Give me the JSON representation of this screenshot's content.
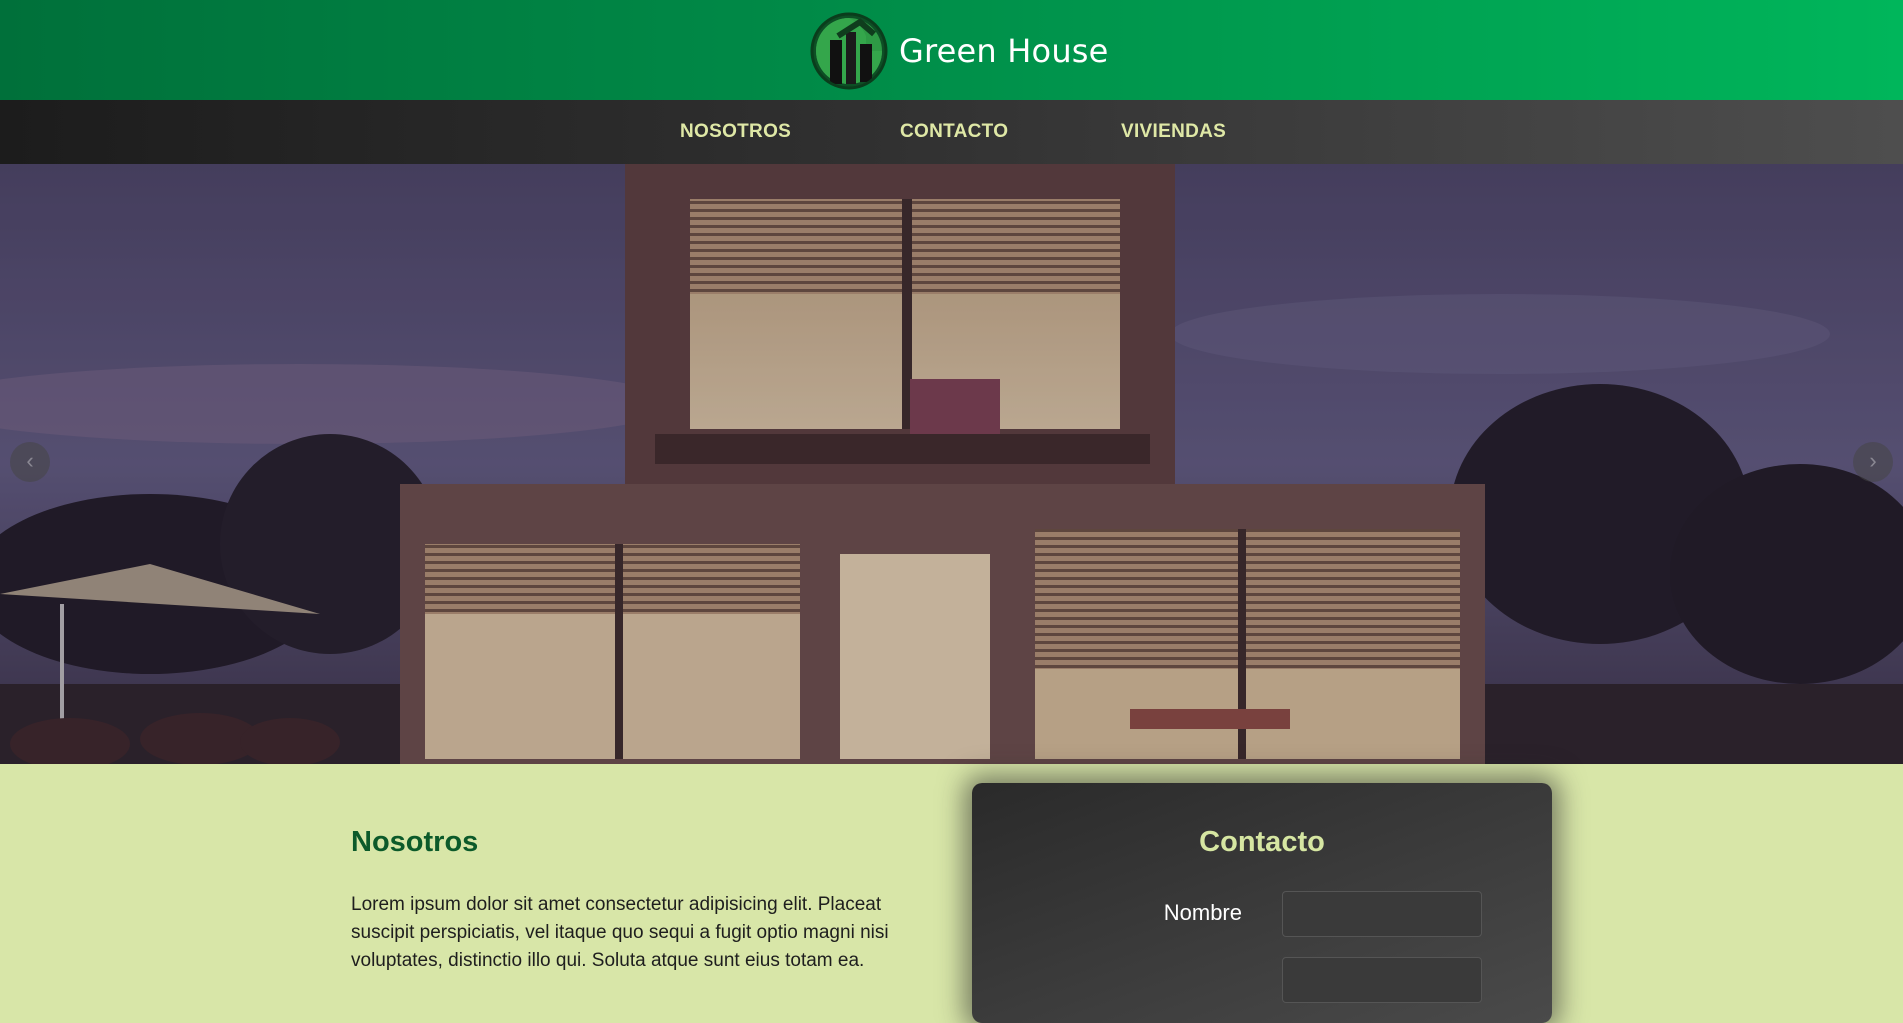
{
  "header": {
    "brand": "Green House",
    "logo_icon": "green-house-logo"
  },
  "nav": {
    "items": [
      {
        "label": "NOSOTROS"
      },
      {
        "label": "CONTACTO"
      },
      {
        "label": "VIVIENDAS"
      }
    ]
  },
  "hero": {
    "image_icon": "modern-house-photo",
    "prev_icon": "chevron-left-icon",
    "next_icon": "chevron-right-icon",
    "prev_glyph": "‹",
    "next_glyph": "›"
  },
  "about": {
    "title": "Nosotros",
    "text": "Lorem ipsum dolor sit amet consectetur adipisicing elit. Placeat suscipit perspiciatis, vel itaque quo sequi a fugit optio magni nisi voluptates, distinctio illo qui. Soluta atque sunt eius totam ea."
  },
  "contact": {
    "title": "Contacto",
    "name_label": "Nombre",
    "name_value": ""
  },
  "colors": {
    "header_green": "#00a852",
    "nav_text": "#dfe8a6",
    "page_bg": "#d8e6a8",
    "title_green": "#0c5a2a"
  }
}
